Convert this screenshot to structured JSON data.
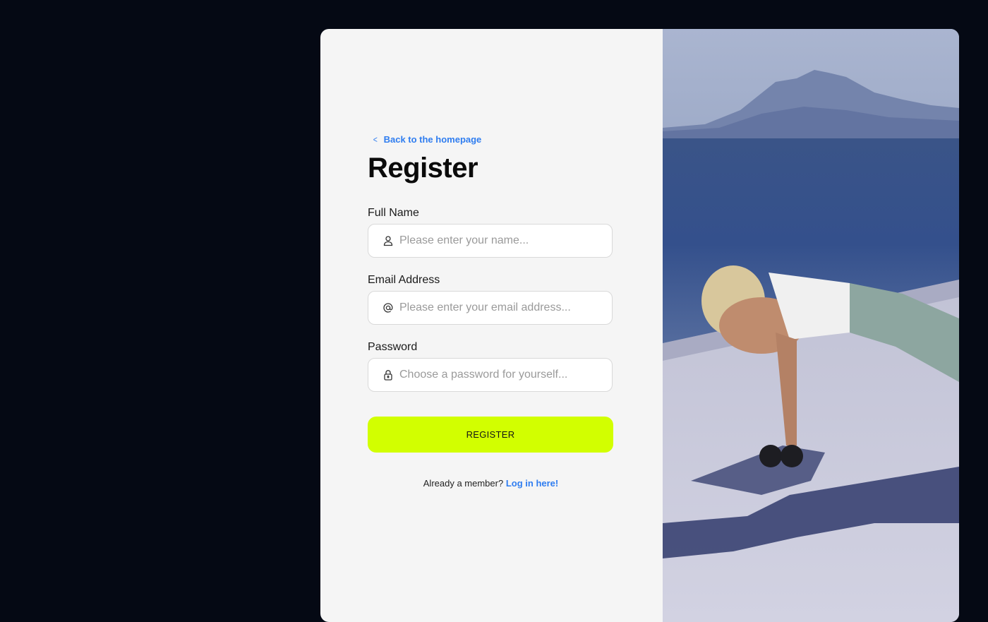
{
  "back_link": {
    "label": "Back to the homepage"
  },
  "title": "Register",
  "fields": [
    {
      "label": "Full Name",
      "placeholder": "Please enter your name...",
      "icon": "user-icon"
    },
    {
      "label": "Email Address",
      "placeholder": "Please enter your email address...",
      "icon": "at-icon"
    },
    {
      "label": "Password",
      "placeholder": "Choose a password for yourself...",
      "icon": "lock-icon"
    }
  ],
  "register_button": {
    "label": "REGISTER"
  },
  "login_prompt": {
    "text": "Already a member?",
    "link": "Log in here!"
  },
  "colors": {
    "page_background": "#050914",
    "form_background": "#f5f5f5",
    "accent": "#d2ff00",
    "link": "#2f7df0"
  }
}
